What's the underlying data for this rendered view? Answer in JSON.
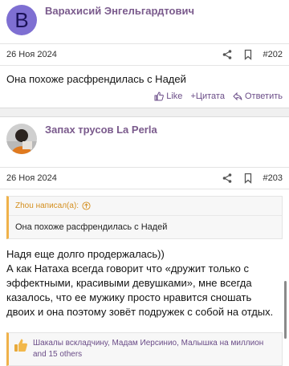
{
  "post1": {
    "username": "Варахисий Энгельгардтович",
    "avatar_letter": "B",
    "date": "26 Ноя 2024",
    "number": "#202",
    "text": "Она похоже расфрендилась с Надей",
    "actions": {
      "like": "Like",
      "quote": "+Цитата",
      "reply": "Ответить"
    }
  },
  "post2": {
    "username": "Запах трусов La Perla",
    "date": "26 Ноя 2024",
    "number": "#203",
    "quote": {
      "author": "Zhou написал(а):",
      "text": "Она похоже расфрендилась с Надей"
    },
    "text_line1": "Надя еще долго продержалась))",
    "text_rest": "А как Натаха всегда говорит что «дружит только с эффектными, красивыми девушками», мне всегда казалось, что ее мужику просто нравится сношать двоих и она поэтому зовёт подружек с собой на отдых.",
    "reactions": "Шакалы вскладчину, Мадам Иерсинио, Малышка на миллион and 15 others"
  },
  "colors": {
    "accent": "#6b4d88",
    "quote_bar": "#f0b24a",
    "avatar_bg": "#7e6fd2"
  },
  "icons": [
    "share-icon",
    "bookmark-icon",
    "like-icon",
    "reply-icon",
    "arrow-up-circle-icon",
    "thumbs-up-icon"
  ]
}
